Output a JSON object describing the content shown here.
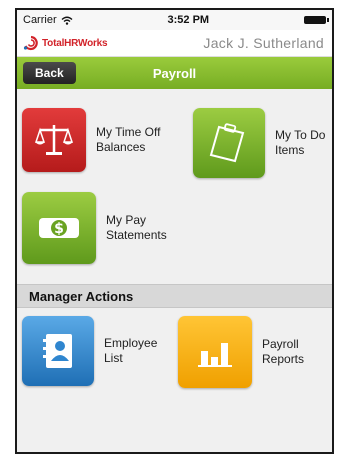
{
  "status_bar": {
    "carrier": "Carrier",
    "time": "3:52 PM"
  },
  "brand": {
    "logo_text": "TotalHRWorks",
    "user_name": "Jack J. Sutherland"
  },
  "navbar": {
    "back_label": "Back",
    "title": "Payroll"
  },
  "payroll_items": [
    {
      "label": "My Time Off Balances",
      "icon": "scale-icon",
      "color": "#d32a2a"
    },
    {
      "label": "My To Do Items",
      "icon": "clipboard-icon",
      "color": "#7db32a"
    },
    {
      "label": "My Pay Statements",
      "icon": "money-icon",
      "color": "#7db32a"
    }
  ],
  "section": {
    "title": "Manager Actions"
  },
  "manager_items": [
    {
      "label": "Employee List",
      "icon": "address-book-icon",
      "color": "#2f86cf"
    },
    {
      "label": "Payroll Reports",
      "icon": "bar-chart-icon",
      "color": "#f7b51a"
    }
  ]
}
